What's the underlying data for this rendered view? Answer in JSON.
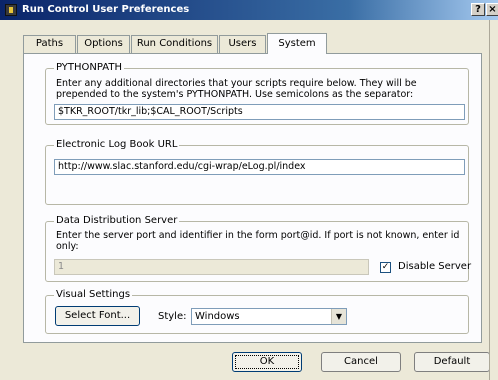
{
  "window": {
    "title": "Run Control User Preferences",
    "help_label": "?",
    "close_label": "×"
  },
  "tabs": [
    {
      "label": "Paths"
    },
    {
      "label": "Options"
    },
    {
      "label": "Run Conditions"
    },
    {
      "label": "Users"
    },
    {
      "label": "System"
    }
  ],
  "active_tab": "System",
  "pythonpath": {
    "title": "PYTHONPATH",
    "description_line1": "Enter any additional directories that your scripts require below. They will be",
    "description_line2": "prepended to the system's PYTHONPATH. Use semicolons as the separator:",
    "value": "$TKR_ROOT/tkr_lib;$CAL_ROOT/Scripts"
  },
  "elog": {
    "title": "Electronic Log Book URL",
    "value": "http://www.slac.stanford.edu/cgi-wrap/eLog.pl/index"
  },
  "dds": {
    "title": "Data Distribution Server",
    "description_line1": "Enter the server port and identifier in the form port@id. If port is not known, enter id",
    "description_line2": "only:",
    "value": "1",
    "disable_checked": true,
    "check_mark": "✓",
    "disable_label": "Disable Server"
  },
  "visual": {
    "title": "Visual Settings",
    "select_font_label": "Select Font...",
    "style_label": "Style:",
    "style_value": "Windows",
    "dropdown_glyph": "▼"
  },
  "buttons": {
    "ok": "OK",
    "cancel": "Cancel",
    "default": "Default"
  }
}
